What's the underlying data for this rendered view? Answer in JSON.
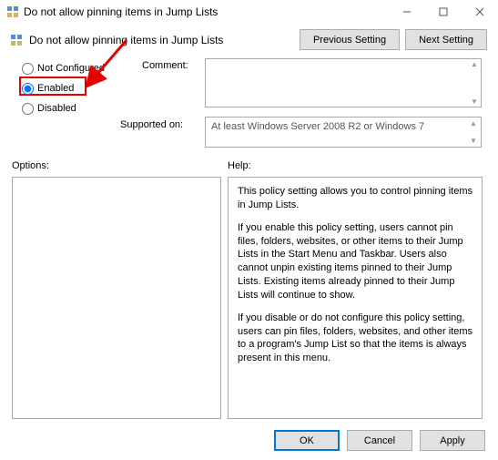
{
  "window": {
    "title": "Do not allow pinning items in Jump Lists"
  },
  "header": {
    "title": "Do not allow pinning items in Jump Lists",
    "prev_btn": "Previous Setting",
    "next_btn": "Next Setting"
  },
  "radio": {
    "not_configured": "Not Configured",
    "enabled": "Enabled",
    "disabled": "Disabled",
    "selected": "enabled"
  },
  "labels": {
    "comment": "Comment:",
    "supported_on": "Supported on:",
    "options": "Options:",
    "help": "Help:"
  },
  "supported_text": "At least Windows Server 2008 R2 or Windows 7",
  "help": {
    "p1": "This policy setting allows you to control pinning items in Jump Lists.",
    "p2": "If you enable this policy setting, users cannot pin files, folders, websites, or other items to their Jump Lists in the Start Menu and Taskbar. Users also cannot unpin existing items pinned to their Jump Lists. Existing items already pinned to their Jump Lists will continue to show.",
    "p3": "If you disable or do not configure this policy setting, users can pin files, folders, websites, and other items to a program's Jump List so that the items is always present in this menu."
  },
  "buttons": {
    "ok": "OK",
    "cancel": "Cancel",
    "apply": "Apply"
  }
}
